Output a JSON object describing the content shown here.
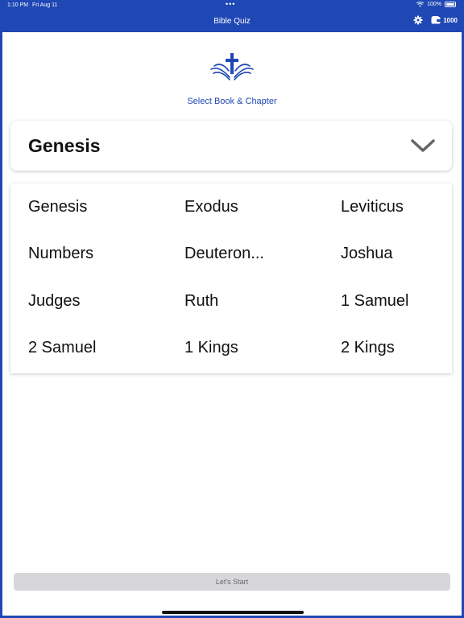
{
  "status": {
    "time": "1:10 PM",
    "date": "Fri Aug 11",
    "battery": "100%"
  },
  "nav": {
    "title": "Bible Quiz",
    "coins": "1000"
  },
  "header": {
    "subtitle": "Select Book & Chapter"
  },
  "selector": {
    "selected": "Genesis"
  },
  "books": [
    "Genesis",
    "Exodus",
    "Leviticus",
    "Numbers",
    "Deuteron...",
    "Joshua",
    "Judges",
    "Ruth",
    "1 Samuel",
    "2 Samuel",
    "1 Kings",
    "2 Kings"
  ],
  "footer": {
    "start_label": "Let's Start"
  },
  "colors": {
    "brand": "#1f48b4",
    "button_disabled": "#d7d7da"
  }
}
